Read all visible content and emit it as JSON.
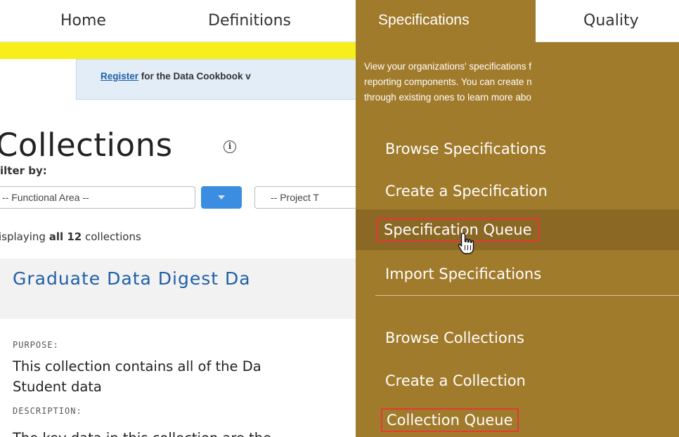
{
  "nav": {
    "home": "Home",
    "definitions": "Definitions",
    "specifications": "Specifications",
    "quality": "Quality"
  },
  "banner": {
    "link": "Register",
    "text": " for the Data Cookbook v"
  },
  "page": {
    "title": "Collections",
    "info_icon": "info-icon",
    "filter_label": "ilter by:",
    "filter_area": "-- Functional Area --",
    "filter_project": "-- Project T",
    "display_prefix": "isplaying ",
    "display_bold": "all 12",
    "display_suffix": " collections"
  },
  "collection": {
    "title": "Graduate Data Digest Da",
    "purpose_label": "PURPOSE:",
    "purpose_line1": "This collection contains all of the Da",
    "purpose_line2": "Student data",
    "description_label": "DESCRIPTION:",
    "description_preview": "The key data in this collection are the"
  },
  "dropdown": {
    "desc_lines": [
      "View your organizations' specifications f",
      "reporting components. You can create n",
      "through existing ones to learn more abo"
    ],
    "items": {
      "browse_specs": "Browse Specifications",
      "create_spec": "Create a Specification",
      "spec_queue": "Specification Queue",
      "import_specs": "Import Specifications",
      "browse_cols": "Browse Collections",
      "create_col": "Create a Collection",
      "col_queue": "Collection Queue"
    }
  },
  "colors": {
    "menu_bg": "#a17b2c",
    "menu_active": "#8b6824",
    "highlight_border": "#e53935",
    "link_blue": "#1f5fa8",
    "warning_yellow": "#f7ef1c"
  }
}
